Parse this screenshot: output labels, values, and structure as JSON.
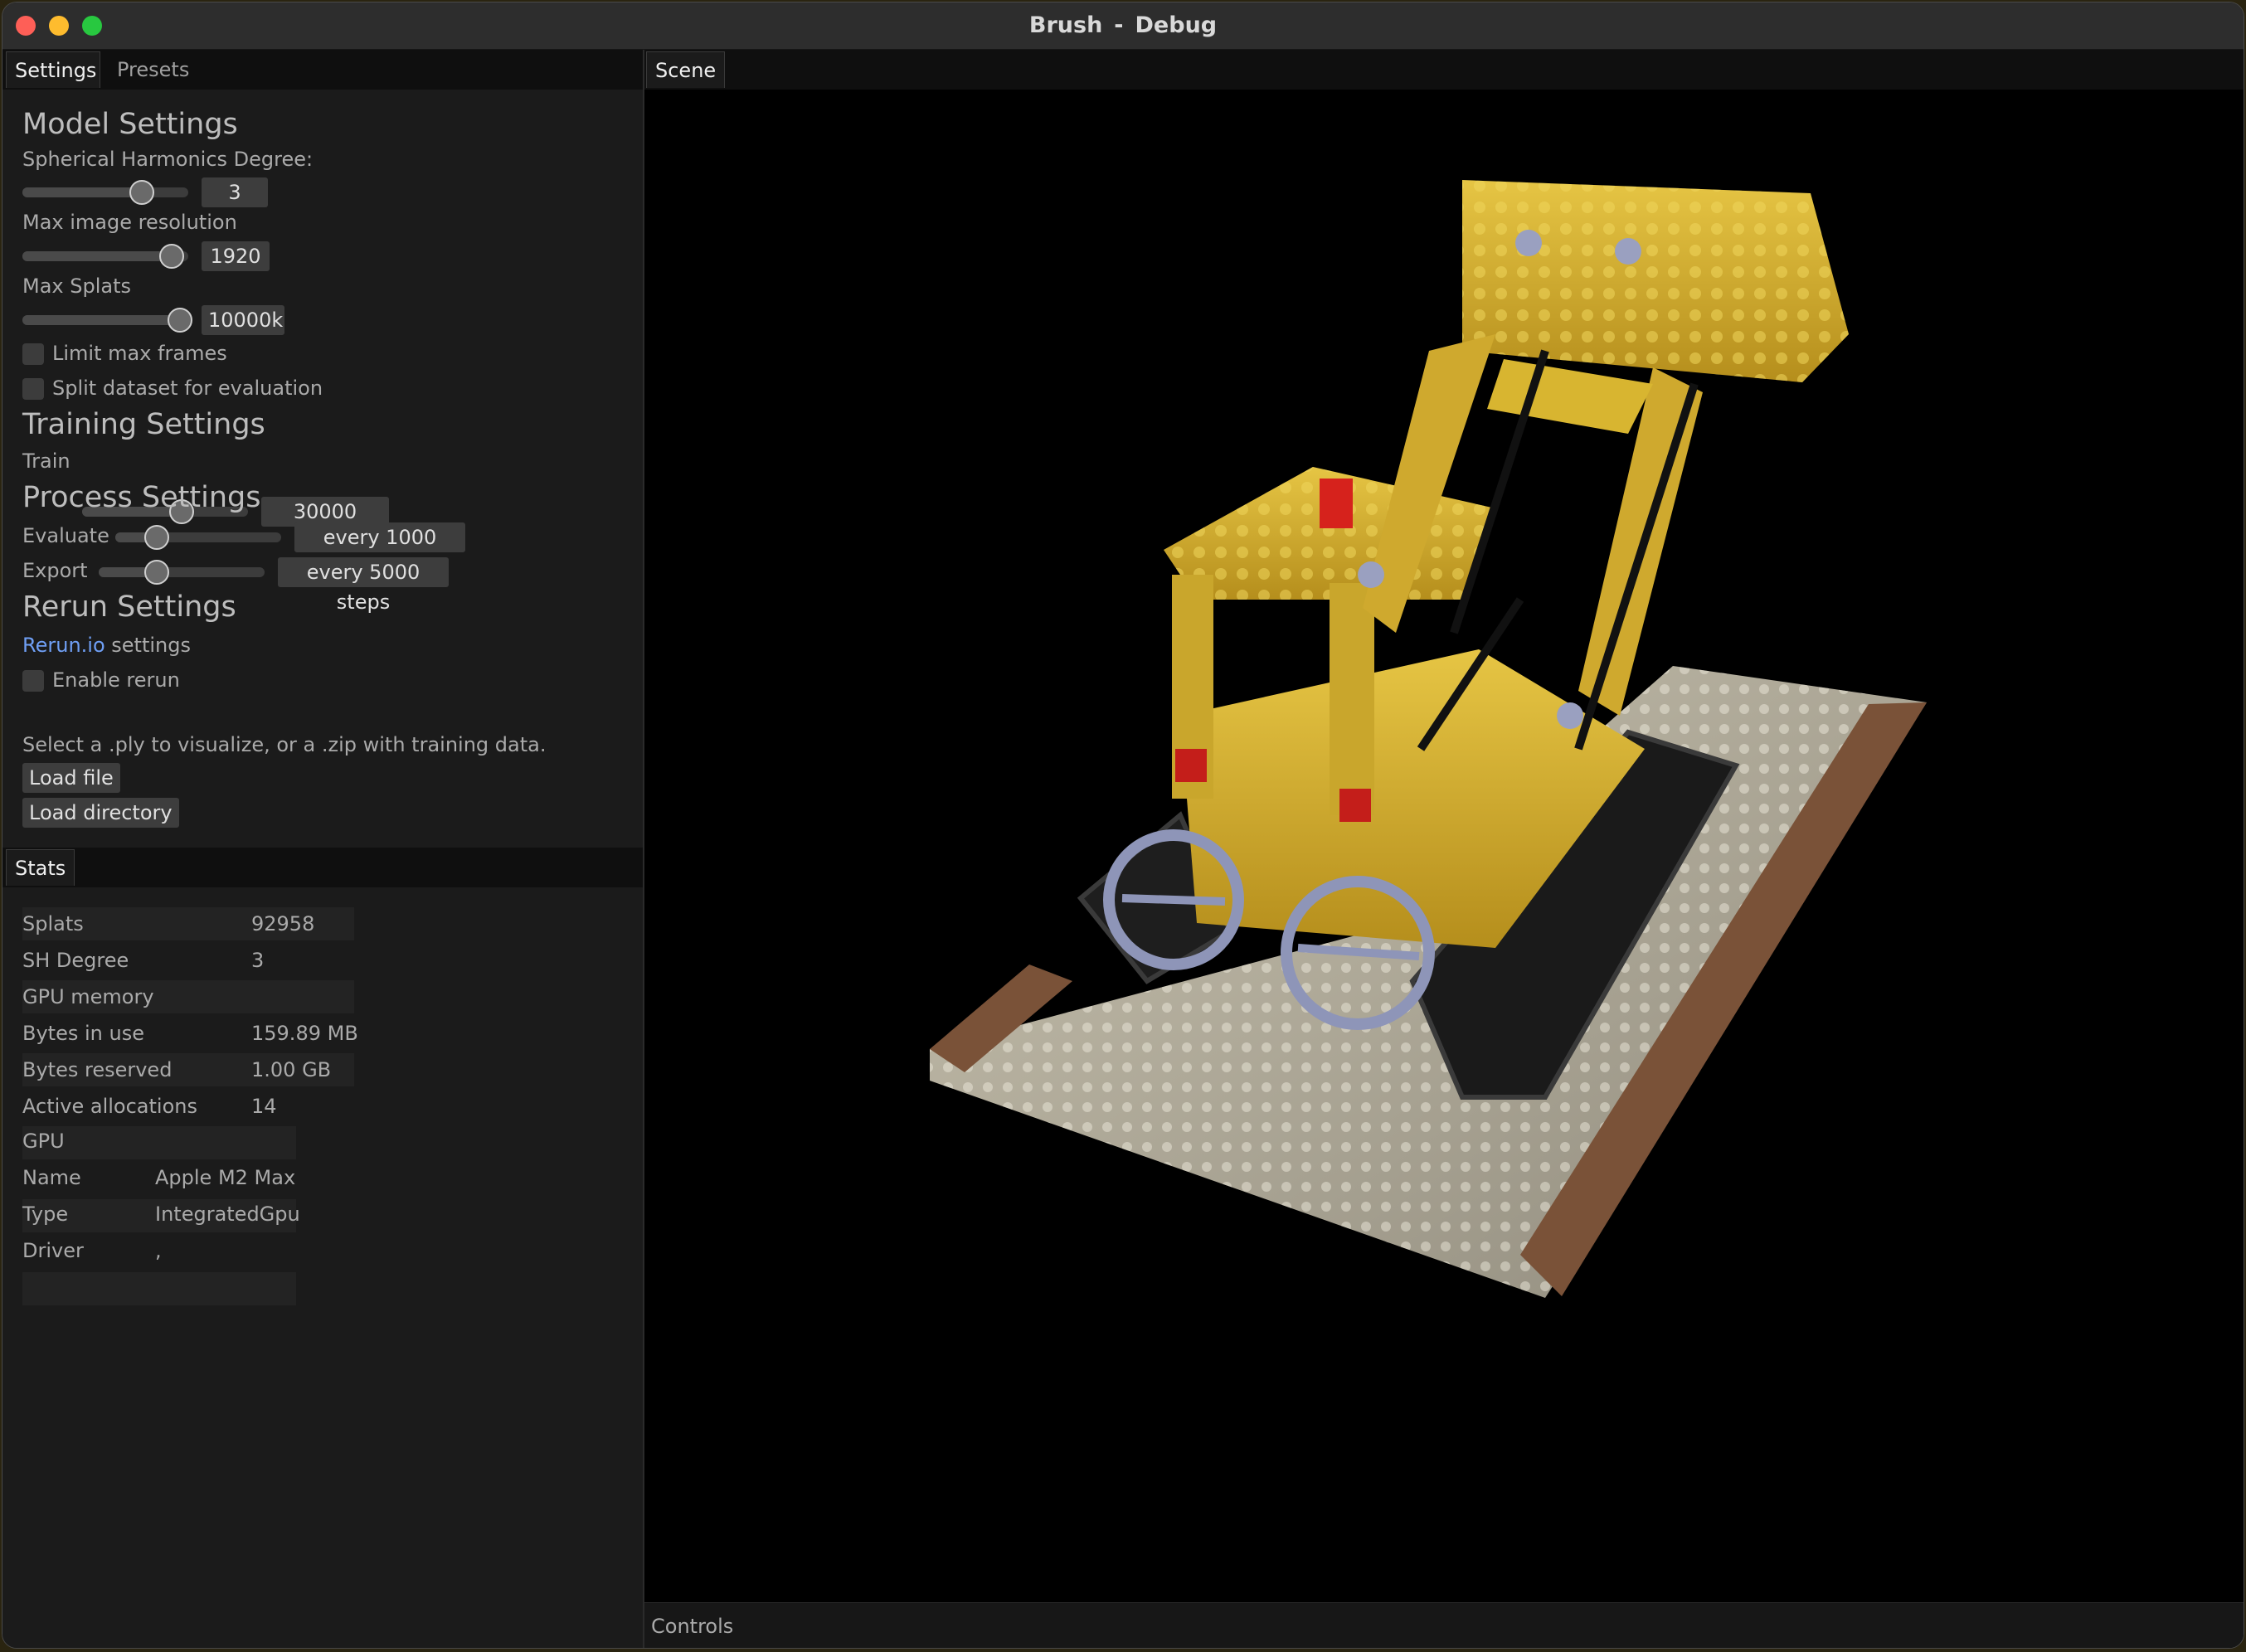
{
  "window": {
    "app": "Brush",
    "separator": "-",
    "mode": "Debug"
  },
  "left_tabs": [
    "Settings",
    "Presets"
  ],
  "settings": {
    "model_heading": "Model Settings",
    "sh_label": "Spherical Harmonics Degree:",
    "sh_value": "3",
    "sh_level": 0.72,
    "res_label": "Max image resolution",
    "res_value": "1920",
    "res_level": 0.9,
    "splats_label": "Max Splats",
    "splats_value": "10000k",
    "splats_level": 0.95,
    "limit_frames_label": "Limit max frames",
    "limit_frames_checked": false,
    "split_label": "Split dataset for evaluation",
    "split_checked": false,
    "training_heading": "Training Settings",
    "train_label": "Train",
    "train_value": "30000 steps",
    "train_level": 0.6,
    "process_heading": "Process Settings",
    "evaluate_label": "Evaluate",
    "evaluate_value": "every 1000 steps",
    "evaluate_level": 0.25,
    "export_label": "Export",
    "export_value": "every 5000 steps",
    "export_level": 0.35,
    "rerun_heading": "Rerun Settings",
    "rerun_link": "Rerun.io",
    "rerun_suffix": " settings",
    "enable_rerun_label": "Enable rerun",
    "enable_rerun_checked": false,
    "hint": "Select a .ply to visualize, or a .zip with training data.",
    "load_file": "Load file",
    "load_directory": "Load directory"
  },
  "stats_tab": "Stats",
  "stats": {
    "splats_label": "Splats",
    "splats_value": "92958",
    "sh_label": "SH Degree",
    "sh_value": "3",
    "gpu_memory_heading": "GPU memory",
    "bytes_in_use_label": "Bytes in use",
    "bytes_in_use_value": "159.89 MB",
    "bytes_reserved_label": "Bytes reserved",
    "bytes_reserved_value": "1.00 GB",
    "active_alloc_label": "Active allocations",
    "active_alloc_value": "14",
    "gpu_heading": "GPU",
    "name_label": "Name",
    "name_value": "Apple M2 Max",
    "type_label": "Type",
    "type_value": "IntegratedGpu",
    "driver_label": "Driver",
    "driver_value": ","
  },
  "scene_tab": "Scene",
  "controls_label": "Controls",
  "colors": {
    "link": "#6f9ff5",
    "lego_yellow": "#d8b530",
    "panel": "#1b1b1b"
  }
}
